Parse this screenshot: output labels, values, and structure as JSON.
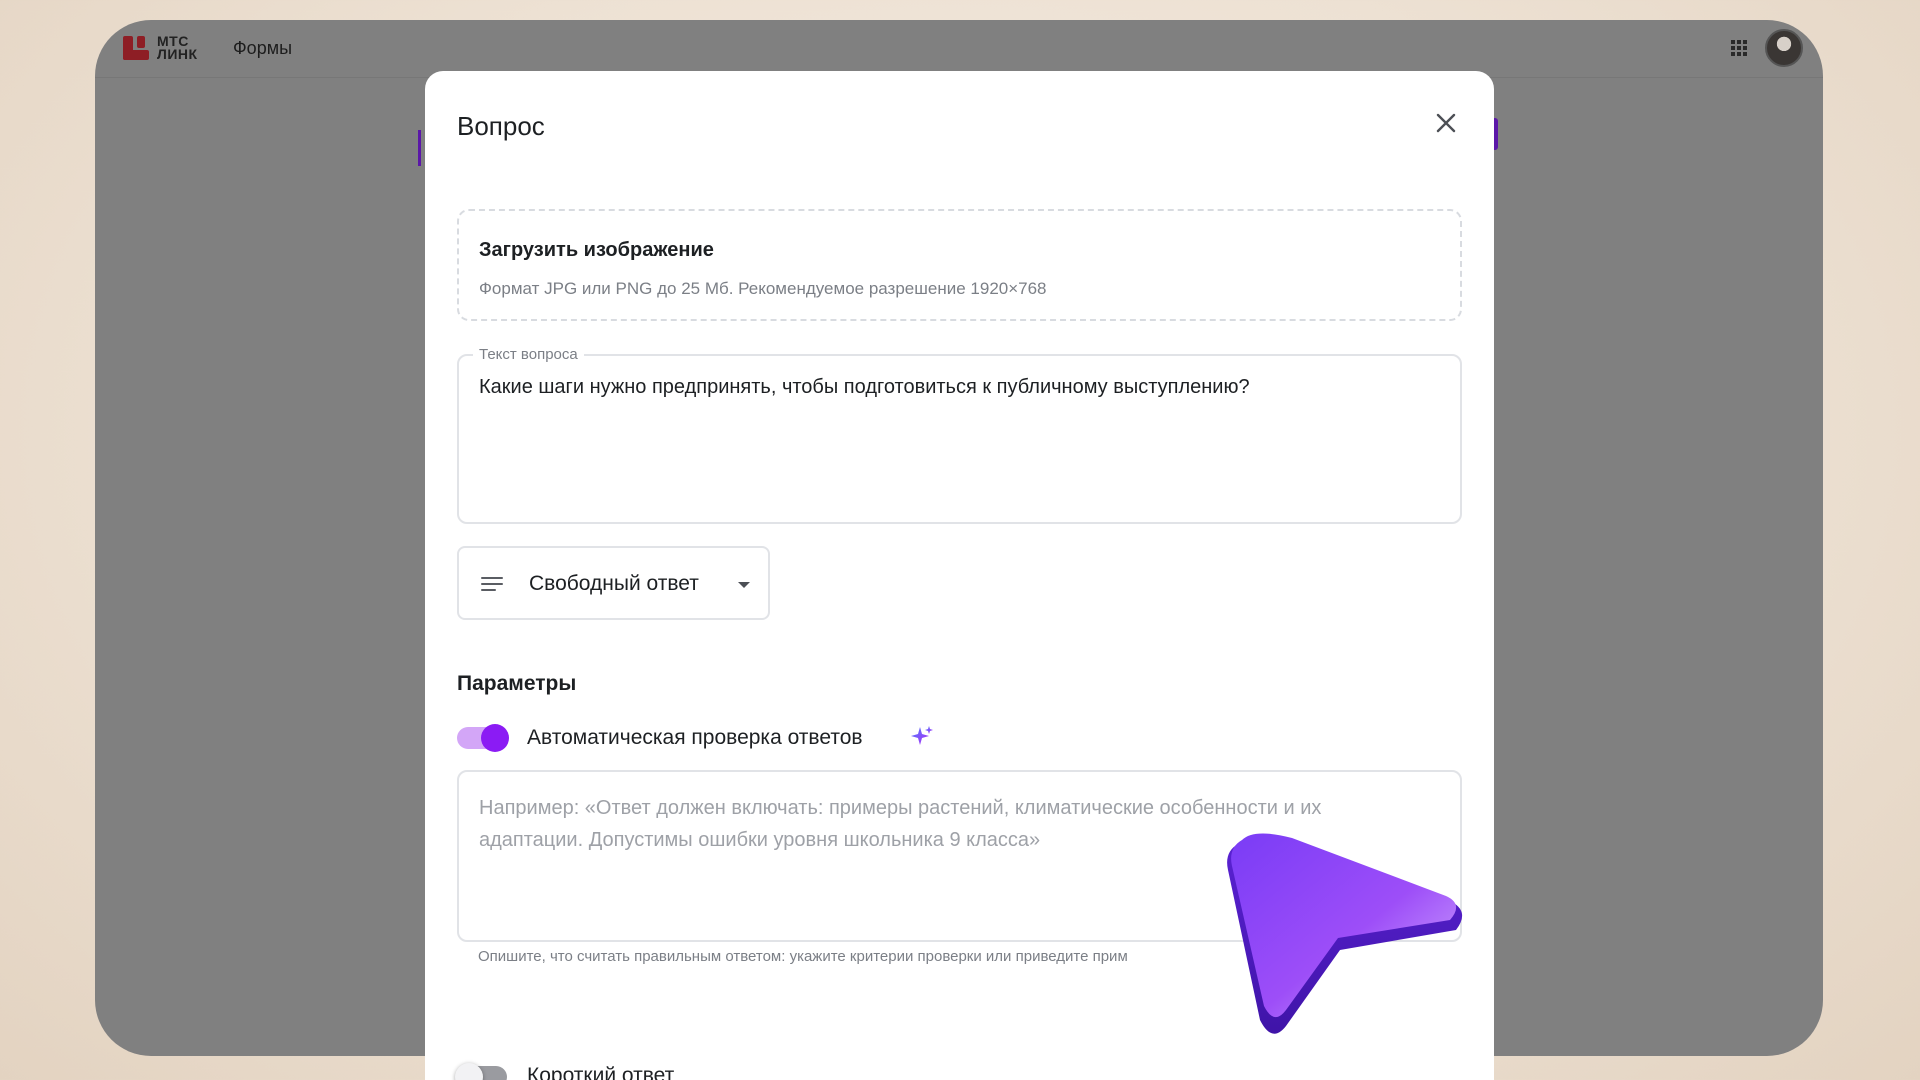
{
  "app": {
    "logo_line1": "МТС",
    "logo_line2": "ЛИНК",
    "nav_title": "Формы",
    "apps_icon": "apps-grid-icon",
    "avatar_icon": "user-avatar"
  },
  "modal": {
    "title": "Вопрос",
    "close_icon": "close-icon",
    "upload": {
      "title": "Загрузить изображение",
      "hint": "Формат JPG или PNG до 25 Мб. Рекомендуемое разрешение 1920×768"
    },
    "question_field": {
      "label": "Текст вопроса",
      "value": "Какие шаги нужно предпринять, чтобы подготовиться к публичному выступлению?"
    },
    "answer_type": {
      "icon": "text-lines-icon",
      "selected": "Свободный ответ"
    },
    "params": {
      "title": "Параметры",
      "auto_check": {
        "label": "Автоматическая проверка ответов",
        "enabled": true,
        "icon": "sparkle-icon"
      },
      "criteria": {
        "placeholder": "Например: «Ответ должен включать: примеры растений, климатические особенности и их адаптации. Допустимы ошибки уровня школьника 9 класса»",
        "help": "Опишите, что считать правильным ответом: укажите критерии проверки или приведите прим"
      },
      "short_answer": {
        "label": "Короткий ответ",
        "enabled": false
      }
    }
  },
  "colors": {
    "accent": "#8b1bf4",
    "accent_light": "#d3a6f7",
    "brand": "#8e1e25",
    "overlay": "#808080"
  }
}
